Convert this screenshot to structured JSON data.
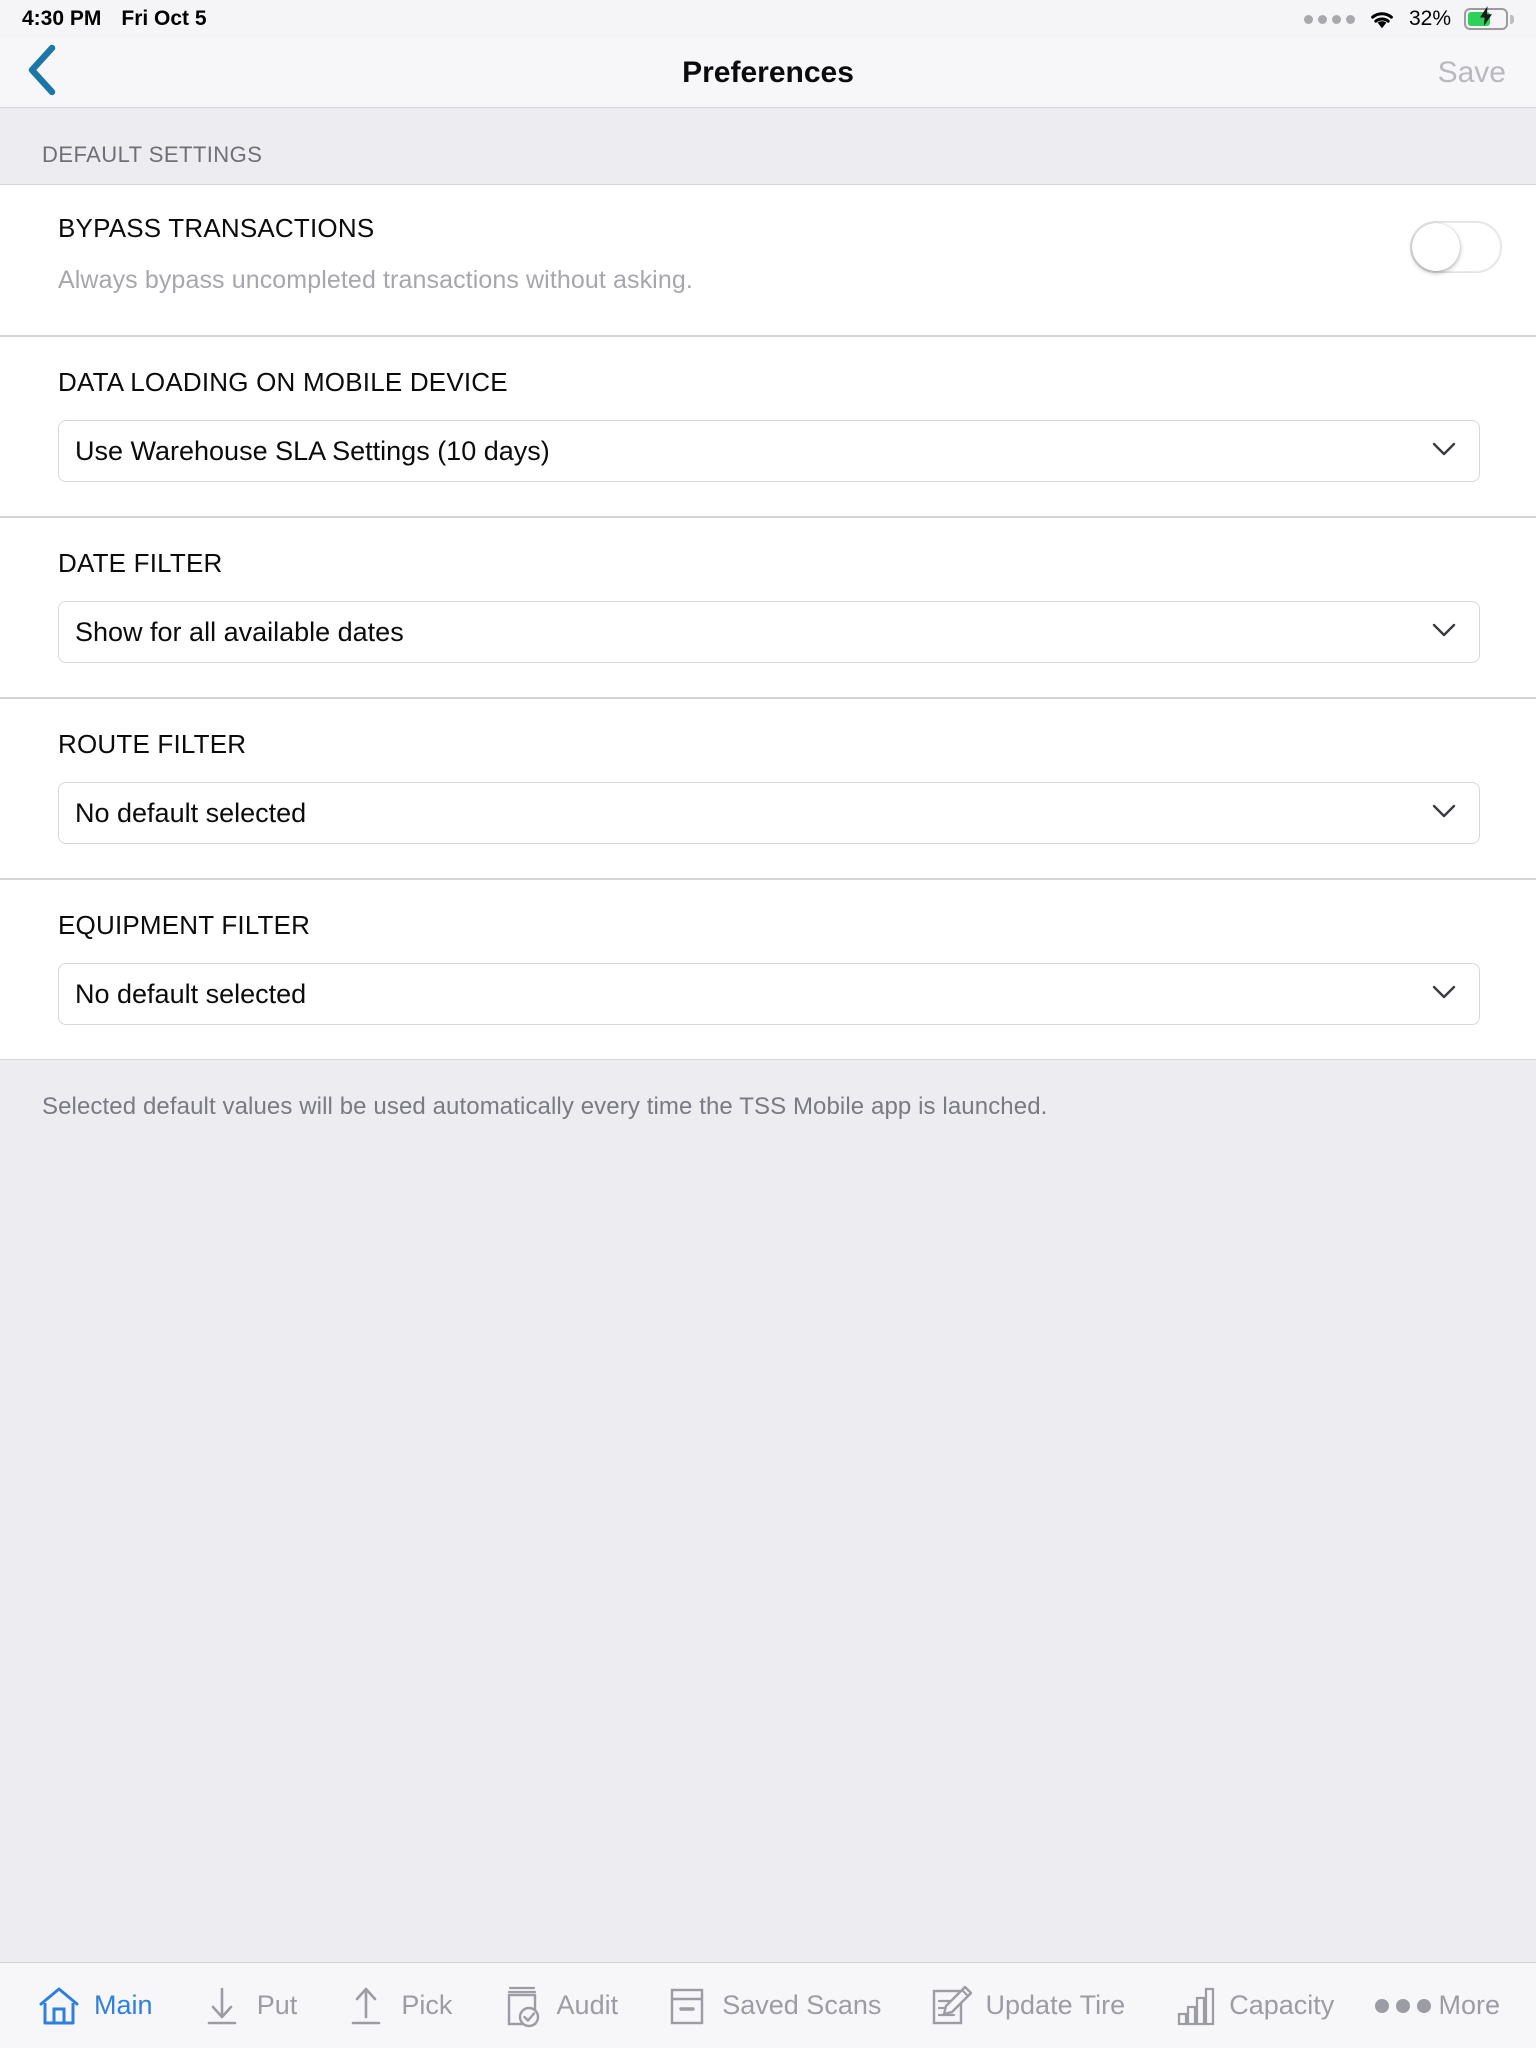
{
  "status_bar": {
    "time": "4:30 PM",
    "date": "Fri Oct 5",
    "battery_percent": "32%",
    "signal_icon": "signal-dots-icon",
    "wifi_icon": "wifi-icon",
    "battery_icon": "battery-charging-icon"
  },
  "nav": {
    "back_icon": "chevron-left-icon",
    "title": "Preferences",
    "save_label": "Save",
    "accent_color": "#1a77a8",
    "save_color": "#b9b9c0"
  },
  "section": {
    "header": "DEFAULT SETTINGS"
  },
  "bypass": {
    "title": "BYPASS TRANSACTIONS",
    "subtitle": "Always bypass uncompleted transactions without asking.",
    "toggle_state": "off"
  },
  "fields": [
    {
      "label": "DATA LOADING ON MOBILE DEVICE",
      "value": "Use Warehouse SLA Settings (10 days)",
      "chevron": "chevron-down-icon"
    },
    {
      "label": "DATE FILTER",
      "value": "Show for all available dates",
      "chevron": "chevron-down-icon"
    },
    {
      "label": "ROUTE FILTER",
      "value": "No default selected",
      "chevron": "chevron-down-icon"
    },
    {
      "label": "EQUIPMENT FILTER",
      "value": "No default selected",
      "chevron": "chevron-down-icon"
    }
  ],
  "footnote": "Selected default values will be used automatically every time the TSS Mobile app is launched.",
  "tabbar": {
    "active_color": "#2e7fe0",
    "inactive_color": "#9c9ca4",
    "items": [
      {
        "label": "Main",
        "icon": "home-icon",
        "active": true
      },
      {
        "label": "Put",
        "icon": "arrow-down-icon",
        "active": false
      },
      {
        "label": "Pick",
        "icon": "arrow-up-icon",
        "active": false
      },
      {
        "label": "Audit",
        "icon": "document-check-icon",
        "active": false
      },
      {
        "label": "Saved Scans",
        "icon": "saved-card-icon",
        "active": false
      },
      {
        "label": "Update Tire",
        "icon": "form-pencil-icon",
        "active": false
      },
      {
        "label": "Capacity",
        "icon": "bar-chart-icon",
        "active": false
      },
      {
        "label": "More",
        "icon": "ellipsis-icon",
        "active": false
      }
    ]
  }
}
